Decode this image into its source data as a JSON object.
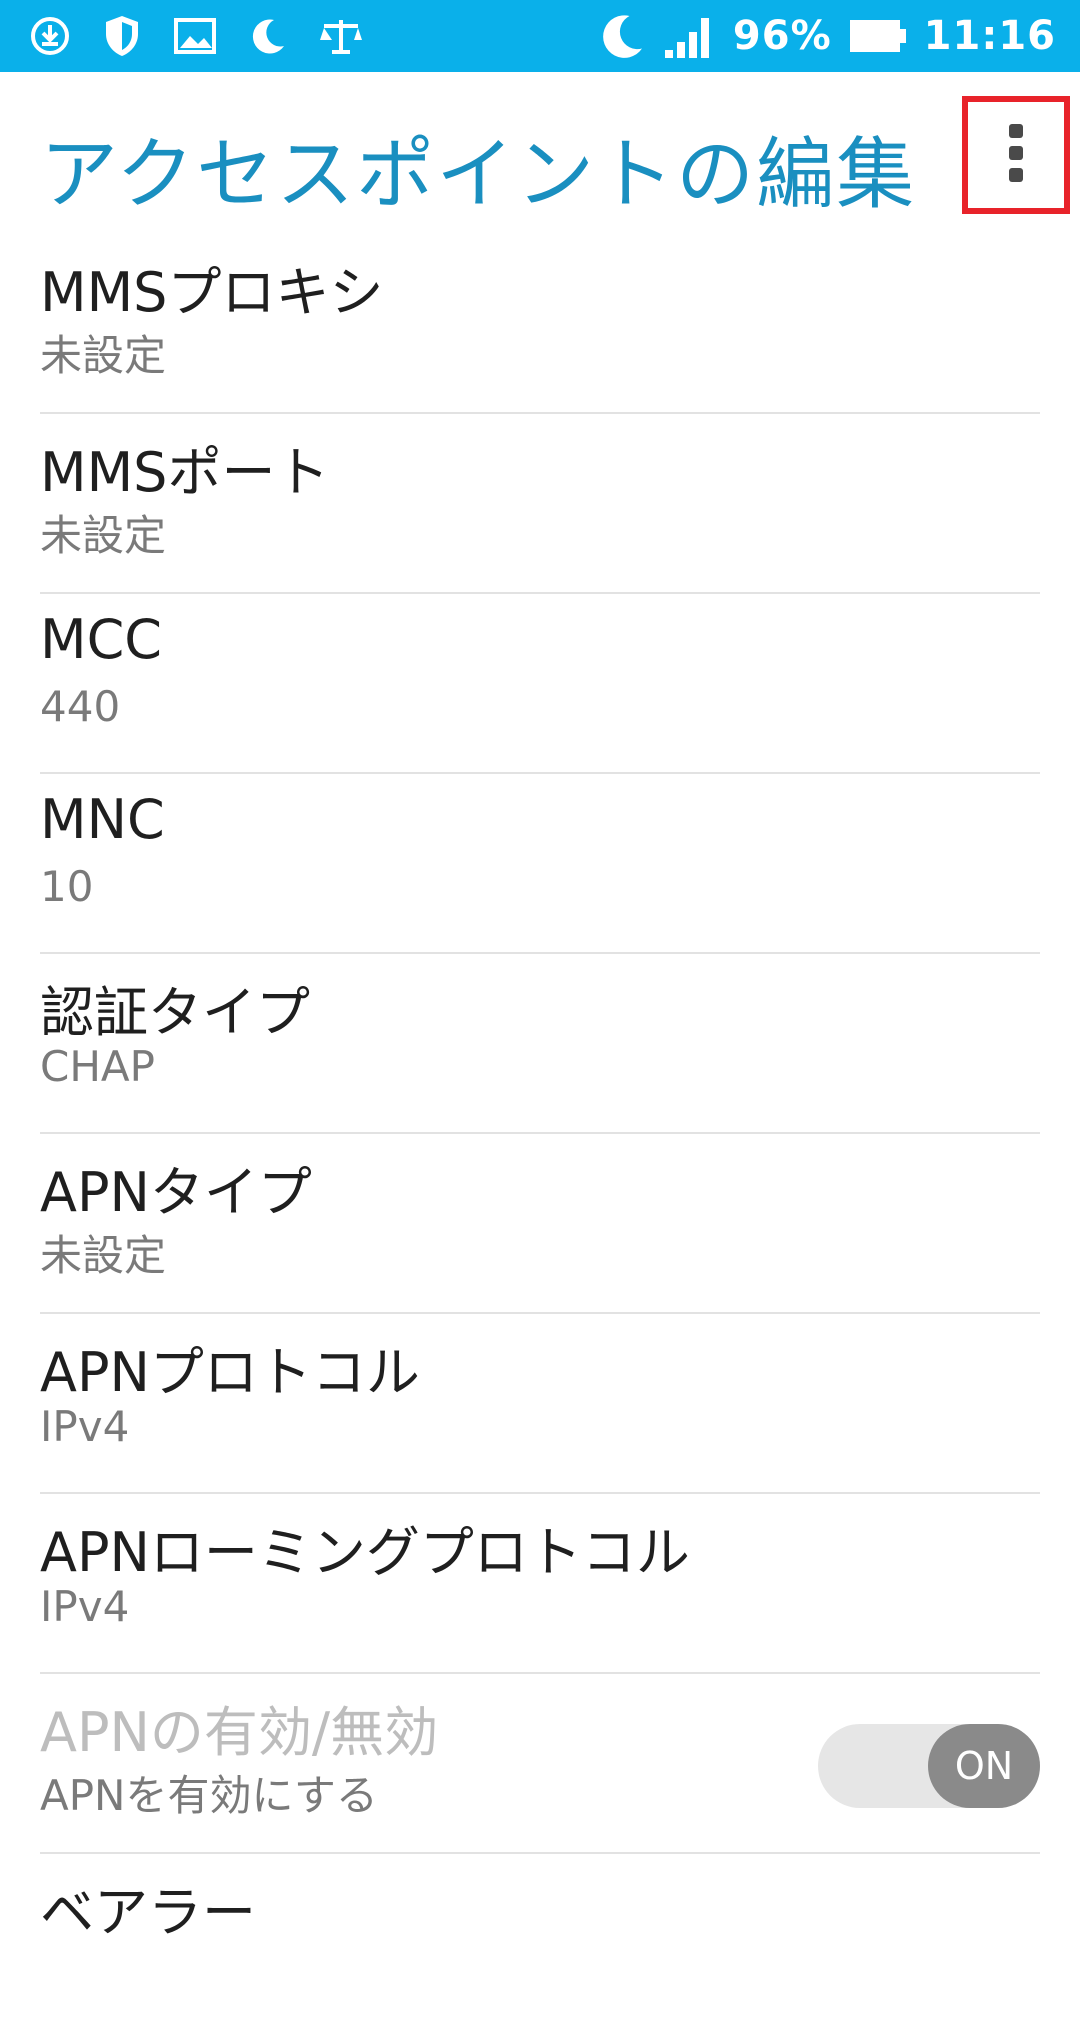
{
  "status_bar": {
    "left_icons": [
      "download-icon",
      "shield-icon",
      "image-icon",
      "moon-icon",
      "scale-icon"
    ],
    "right_icons": [
      "moon-icon",
      "signal-icon",
      "battery-icon"
    ],
    "battery": "96%",
    "time": "11:16",
    "background": "#0ab0ea"
  },
  "header": {
    "title": "アクセスポイントの編集",
    "title_color": "#1a8fc0",
    "menu_icon": "more-vert-icon",
    "highlight_color": "#e8232a"
  },
  "settings": [
    {
      "title": "MMSプロキシ",
      "value": "未設定"
    },
    {
      "title": "MMSポート",
      "value": "未設定"
    },
    {
      "title": "MCC",
      "value": "440"
    },
    {
      "title": "MNC",
      "value": "10"
    },
    {
      "title": "認証タイプ",
      "value": "CHAP"
    },
    {
      "title": "APNタイプ",
      "value": "未設定"
    },
    {
      "title": "APNプロトコル",
      "value": "IPv4"
    },
    {
      "title": "APNローミングプロトコル",
      "value": "IPv4"
    }
  ],
  "apn_enable": {
    "title": "APNの有効/無効",
    "subtitle": "APNを有効にする",
    "toggle_label": "ON",
    "enabled": true
  },
  "bearer": {
    "title": "ベアラー"
  }
}
